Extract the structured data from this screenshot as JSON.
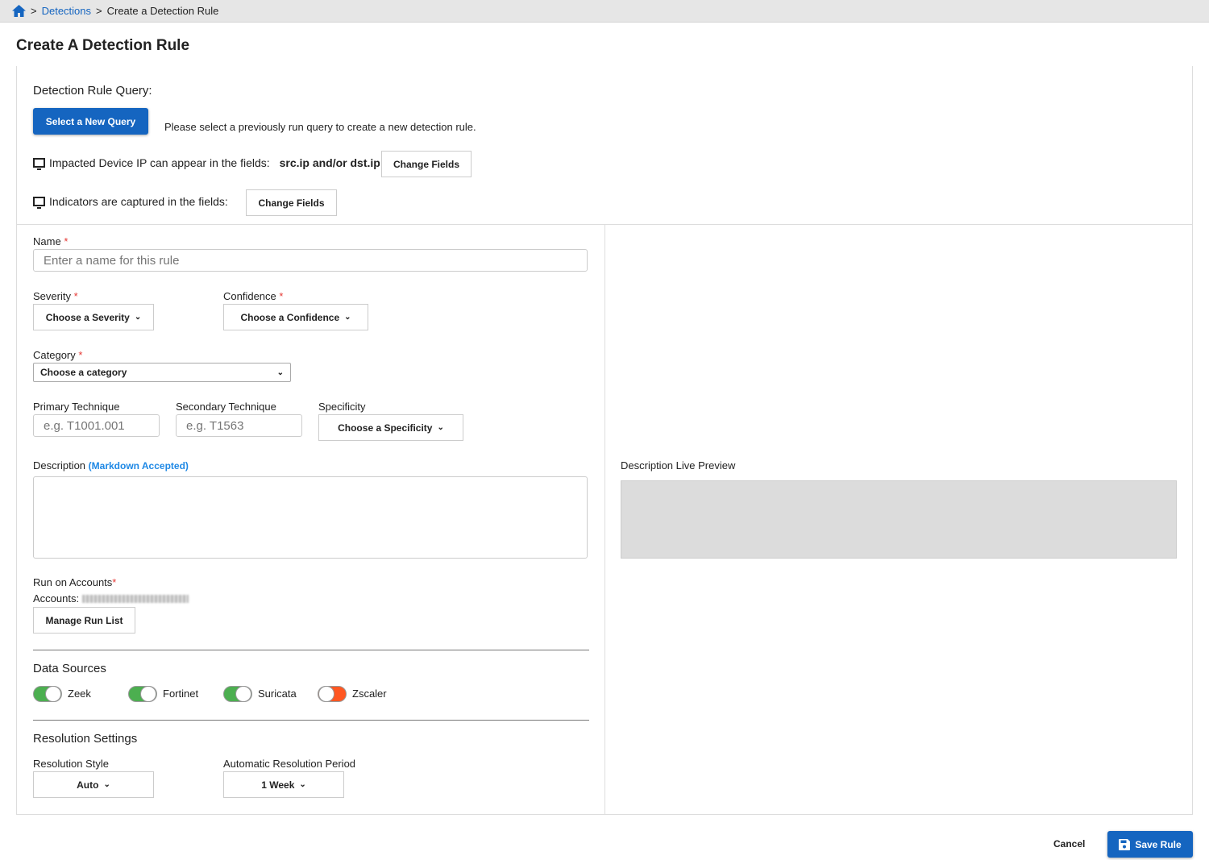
{
  "breadcrumb": {
    "home_icon": "home-icon",
    "items": [
      "Detections",
      "Create a Detection Rule"
    ],
    "sep": ">"
  },
  "page_title": "Create A Detection Rule",
  "query": {
    "heading": "Detection Rule Query:",
    "select_button": "Select a New Query",
    "hint": "Please select a previously run query to create a new detection rule.",
    "impacted_label": "Impacted Device IP can appear in the fields:",
    "impacted_fields": "src.ip and/or dst.ip",
    "change_fields": "Change Fields",
    "indicators_label": "Indicators are captured in the fields:"
  },
  "form": {
    "name_label": "Name",
    "name_placeholder": "Enter a name for this rule",
    "required": "*",
    "severity_label": "Severity",
    "severity_value": "Choose a Severity",
    "confidence_label": "Confidence",
    "confidence_value": "Choose a Confidence",
    "category_label": "Category",
    "category_value": "Choose a category",
    "primary_label": "Primary Technique",
    "primary_placeholder": "e.g. T1001.001",
    "secondary_label": "Secondary Technique",
    "secondary_placeholder": "e.g. T1563",
    "specificity_label": "Specificity",
    "specificity_value": "Choose a Specificity",
    "description_label": "Description",
    "markdown_note": "(Markdown Accepted)",
    "run_label": "Run on Accounts",
    "accounts_label": "Accounts:",
    "manage_button": "Manage Run List",
    "data_sources_heading": "Data Sources",
    "data_sources": [
      {
        "name": "Zeek",
        "enabled": true
      },
      {
        "name": "Fortinet",
        "enabled": true
      },
      {
        "name": "Suricata",
        "enabled": true
      },
      {
        "name": "Zscaler",
        "enabled": false
      }
    ],
    "resolution_heading": "Resolution Settings",
    "resolution_style_label": "Resolution Style",
    "resolution_style_value": "Auto",
    "period_label": "Automatic Resolution Period",
    "period_value": "1 Week"
  },
  "preview": {
    "label": "Description Live Preview"
  },
  "footer": {
    "cancel": "Cancel",
    "save": "Save Rule"
  },
  "colors": {
    "accent": "#1565c0",
    "on": "#4caf50",
    "off": "#ff5722"
  }
}
